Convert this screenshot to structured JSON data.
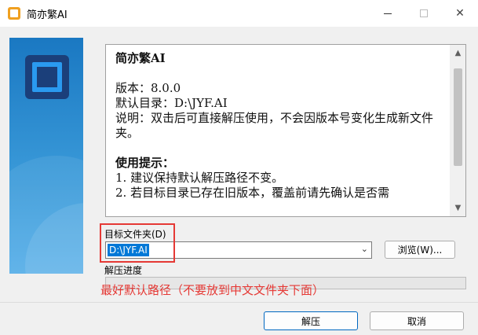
{
  "window": {
    "title": "简亦繁AI",
    "minimize_glyph": "—",
    "close_glyph": "✕"
  },
  "info": {
    "heading": "简亦繁AI",
    "version": "版本：8.0.0",
    "default_dir": "默认目录：D:\\JYF.AI",
    "description": "说明：双击后可直接解压使用，不会因版本号变化生成新文件夹。",
    "tips_heading": "使用提示：",
    "tip1": "1. 建议保持默认解压路径不变。",
    "tip2": "2. 若目标目录已存在旧版本，覆盖前请先确认是否需"
  },
  "target": {
    "label": "目标文件夹(D)",
    "value": "D:\\JYF.AI",
    "dropdown_glyph": "⌄"
  },
  "buttons": {
    "browse": "浏览(W)...",
    "extract": "解压",
    "cancel": "取消"
  },
  "progress": {
    "label": "解压进度",
    "fraction": 0
  },
  "annotation": {
    "text": "最好默认路径（不要放到中文文件夹下面）",
    "color": "#e53935"
  },
  "scroll": {
    "up_glyph": "▲",
    "down_glyph": "▼"
  }
}
